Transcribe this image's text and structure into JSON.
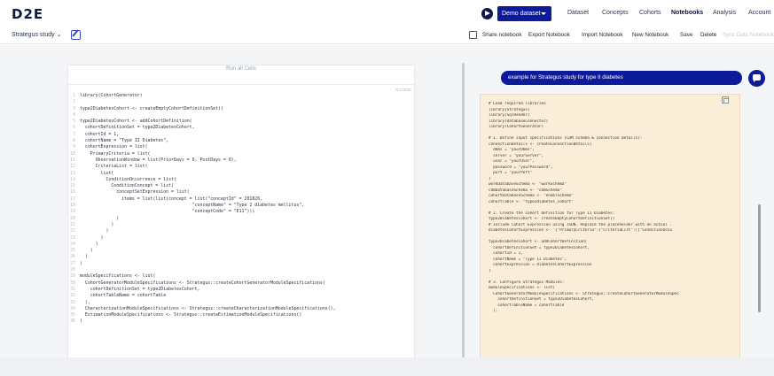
{
  "app": {
    "logo": "D2E"
  },
  "nav": {
    "dataset_button": "Demo dataset",
    "items": [
      {
        "label": "Dataset",
        "active": false
      },
      {
        "label": "Concepts",
        "active": false
      },
      {
        "label": "Cohorts",
        "active": false
      },
      {
        "label": "Notebooks",
        "active": true
      },
      {
        "label": "Analysis",
        "active": false
      },
      {
        "label": "Account",
        "active": false
      }
    ]
  },
  "subbar": {
    "study_select": "Strategus study",
    "actions": [
      {
        "label": "Share notebook",
        "disabled": false
      },
      {
        "label": "Export Notebook",
        "disabled": false
      },
      {
        "label": "Import Notebook",
        "disabled": false
      },
      {
        "label": "New Notebook",
        "disabled": false
      },
      {
        "label": "Save",
        "disabled": false
      },
      {
        "label": "Delete",
        "disabled": false
      },
      {
        "label": "Sync Data Notebook",
        "disabled": true
      }
    ]
  },
  "editor": {
    "run_cells_label": "Run all Cells",
    "language_label": "R CODE",
    "lines": [
      "library(CohortGenerator)",
      "",
      "type2DiabetesCohort <- createEmptyCohortDefinitionSet()",
      "",
      "type2DiabetesCohort <- addCohortDefinition(",
      "  cohortDefinitionSet = type2DiabetesCohort,",
      "  cohortId = 1,",
      "  cohortName = \"Type II Diabetes\",",
      "  cohortExpression = list(",
      "    PrimaryCriteria = list(",
      "      ObservationWindow = list(PriorDays = 0, PostDays = 0),",
      "      CriteriaList = list(",
      "        list(",
      "          ConditionOccurrence = list(",
      "            ConditionConcept = list(",
      "              conceptSetExpression = list(",
      "                items = list(list(concept = list(\"conceptId\" = 201826,",
      "                                           \"conceptName\" = \"Type 2 diabetes mellitus\",",
      "                                           \"conceptCode\" = \"E11\")))",
      "              )",
      "            )",
      "          )",
      "        )",
      "      )",
      "    )",
      "  )",
      ")",
      "",
      "moduleSpecifications <- list(",
      "  CohortGeneratorModuleSpecifications <- Strategus::createCohortGeneratorModuleSpecifications(",
      "    cohortDefinitionSet = type2DiabetesCohort,",
      "    cohortTableName = cohortTable",
      "  ),",
      "  CharacterizationModuleSpecifications <- Strategus::createCharacterizationModuleSpecifications(),",
      "  EstimationModuleSpecifications <- Strategus::createEstimationModuleSpecifications()",
      ")"
    ]
  },
  "chat": {
    "prompt": "example for Strategus study for type II diabetes",
    "reply_lines": [
      "# Load required libraries",
      "library(Strategus)",
      "library(SqlRender)",
      "library(DatabaseConnector)",
      "library(CohortGenerator)",
      "",
      "# 1. Define input specifications (CDM schema & connection details):",
      "connectionDetails <- createConnectionDetails(",
      "  dbms = \"yourDbms\",",
      "  server = \"yourServer\",",
      "  user = \"yourUser\",",
      "  password = \"yourPassword\",",
      "  port = \"yourPort\"",
      ")",
      "workDatabaseSchema <- \"workSchema\"",
      "cdmDatabaseSchema <- \"cdmSchema\"",
      "cohortDatabaseSchema <- \"enablSchema\"",
      "cohortTable <- \"type2diabetes_cohort\"",
      "",
      "# 2. Create the cohort definition for Type II Diabetes:",
      "type2DiabetesCohort <- createEmptyCohortDefinitionSet()",
      "# Include Cohort Expression using JSON. Replace the placeholder with an actual .",
      "diabetesCohortExpression <- '{\"PrimaryCriteria\":{\"CriteriaList\":[{\"ConditionOccu",
      "",
      "type2DiabetesCohort <- addCohortDefinition(",
      "  cohortDefinitionSet = type2DiabetesCohort,",
      "  cohortId = 1,",
      "  cohortName = \"Type II Diabetes\",",
      "  cohortExpression = diabetesCohortExpression",
      ")",
      "",
      "# 3. Configure Strategus Modules:",
      "moduleSpecifications <- list(",
      "  CohortGeneratorModuleSpecifications <- Strategus::createCohortGeneratorModuleSpec",
      "    cohortDefinitionSet = type2DiabetesCohort,",
      "    cohortTableName = cohortTable",
      "  ),"
    ]
  }
}
